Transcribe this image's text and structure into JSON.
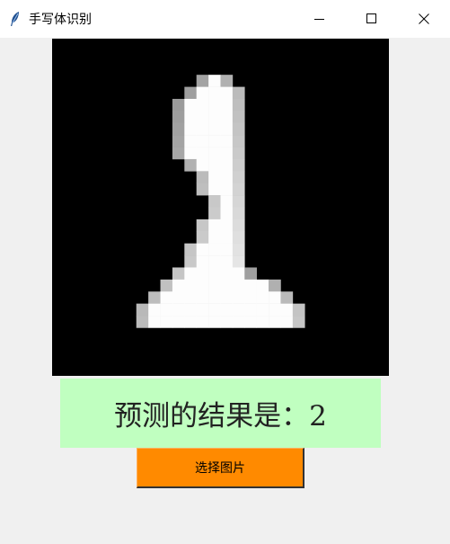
{
  "window": {
    "title": "手写体识别",
    "icon": "feather-icon",
    "controls": [
      "minimize-icon",
      "maximize-icon",
      "close-icon"
    ]
  },
  "image": {
    "description_icon": "digit-image",
    "grid_size": 28,
    "background": "#000000"
  },
  "result": {
    "text": "预测的结果是：2",
    "background": "#c0ffc0"
  },
  "button": {
    "label": "选择图片",
    "color": "#ff8a00"
  }
}
